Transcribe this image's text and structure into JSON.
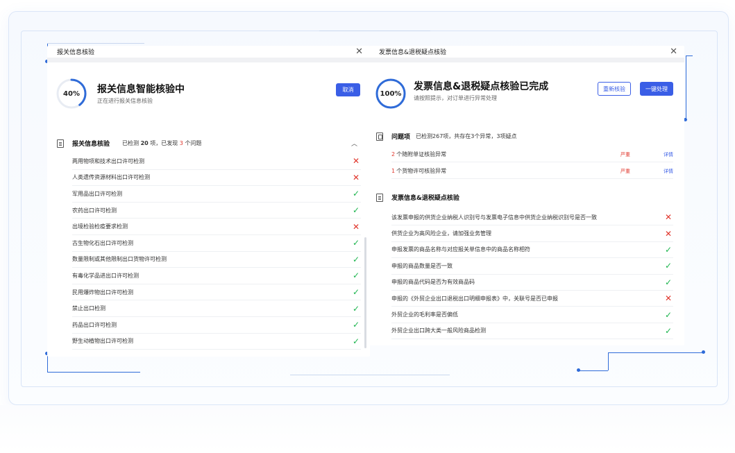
{
  "left_panel": {
    "title": "报关信息核验",
    "progress_label": "40%",
    "progress_fraction": 0.4,
    "heading": "报关信息智能核验中",
    "subheading": "正在进行报关信息核验",
    "cancel_label": "取消",
    "section": {
      "title": "报关信息核验",
      "meta_prefix": "已检测",
      "meta_count": "20",
      "meta_mid": "项，已发现",
      "meta_issues": "3",
      "meta_suffix": "个问题"
    },
    "items": [
      {
        "label": "两用物项和技术出口许可检测",
        "status": "fail"
      },
      {
        "label": "人类遗传资源材料出口许可检测",
        "status": "fail"
      },
      {
        "label": "军用品出口许可检测",
        "status": "pass"
      },
      {
        "label": "农药出口许可检测",
        "status": "pass"
      },
      {
        "label": "出境检验检疫要求检测",
        "status": "fail"
      },
      {
        "label": "古生物化石出口许可检测",
        "status": "pass"
      },
      {
        "label": "数量限制或其他限制出口货物许可检测",
        "status": "pass"
      },
      {
        "label": "有毒化学品进出口许可检测",
        "status": "pass"
      },
      {
        "label": "民用爆炸物出口许可检测",
        "status": "pass"
      },
      {
        "label": "禁止出口检测",
        "status": "pass"
      },
      {
        "label": "药品出口许可检测",
        "status": "pass"
      },
      {
        "label": "野生动植物出口许可检测",
        "status": "pass"
      }
    ]
  },
  "right_panel": {
    "title": "发票信息&退税疑点核验",
    "progress_label": "100%",
    "progress_fraction": 1.0,
    "heading": "发票信息&退税疑点核验已完成",
    "subheading": "请按照提示，对订单进行异常处理",
    "recheck_label": "重新核验",
    "one_click_label": "一键处理",
    "issues_section": {
      "title": "问题项",
      "meta": "已检测267项，共存在3个异常，3项疑点"
    },
    "issues": [
      {
        "count": "2",
        "label": "个随附单证核验异常",
        "severity": "严重",
        "action": "详情"
      },
      {
        "count": "1",
        "label": "个货物许可核验异常",
        "severity": "严重",
        "action": "详情"
      }
    ],
    "check_section": {
      "title": "发票信息&退税疑点核验"
    },
    "items": [
      {
        "label": "该发票申报的供货企业纳税人识别号与发票电子信息中供货企业纳税识别号是否一致",
        "status": "fail"
      },
      {
        "label": "供货企业为高风险企业，请加强业务管理",
        "status": "fail"
      },
      {
        "label": "申报发票的商品名称与对应报关单信息中的商品名称相符",
        "status": "pass"
      },
      {
        "label": "申报的商品数量是否一致",
        "status": "pass"
      },
      {
        "label": "申报的商品代码是否为有效商品码",
        "status": "pass"
      },
      {
        "label": "申报的《外贸企业出口退税出口明细申报表》中，关联号是否已申报",
        "status": "fail"
      },
      {
        "label": "外贸企业的毛利率是否偏低",
        "status": "pass"
      },
      {
        "label": "外贸企业出口跨大类一般风险商品检测",
        "status": "pass"
      }
    ]
  },
  "colors": {
    "accent": "#3a5ee6",
    "ring": "#2f6bd8",
    "fail": "#e0352b",
    "pass": "#1db54e"
  },
  "icons": {
    "close": "close-icon",
    "fail": "x-mark-icon",
    "pass": "check-mark-icon",
    "collapse": "chevron-up-icon",
    "document": "document-icon"
  }
}
